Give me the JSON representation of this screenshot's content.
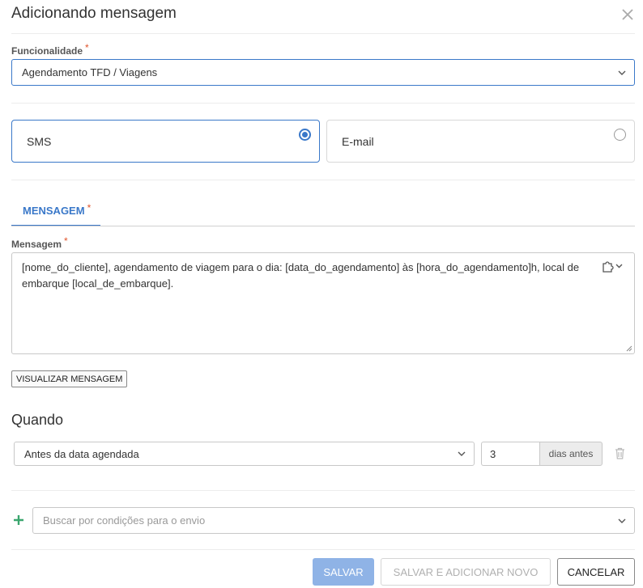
{
  "dialog": {
    "title": "Adicionando mensagem",
    "close_icon": "close-icon"
  },
  "funcionalidade": {
    "label": "Funcionalidade",
    "required_mark": "*",
    "value": "Agendamento TFD / Viagens"
  },
  "channels": [
    {
      "label": "SMS",
      "selected": true
    },
    {
      "label": "E-mail",
      "selected": false
    }
  ],
  "tab": {
    "label": "MENSAGEM",
    "required_mark": "*"
  },
  "mensagem": {
    "label": "Mensagem",
    "required_mark": "*",
    "value": "[nome_do_cliente], agendamento de viagem para o dia: [data_do_agendamento] às [hora_do_agendamento]h, local de embarque [local_de_embarque].",
    "insert_icon": "puzzle-icon"
  },
  "preview_button": "VISUALIZAR MENSAGEM",
  "quando": {
    "title": "Quando",
    "when_value": "Antes da data agendada",
    "days_value": "3",
    "days_suffix": "dias antes"
  },
  "conditions": {
    "placeholder": "Buscar por condições para o envio"
  },
  "footer": {
    "save": "SALVAR",
    "save_and_new": "SALVAR E ADICIONAR NOVO",
    "cancel": "CANCELAR"
  },
  "colors": {
    "accent": "#3a78c9",
    "required": "#e0542c",
    "add": "#3aa66e",
    "primary_disabled": "#8fb3e6"
  }
}
